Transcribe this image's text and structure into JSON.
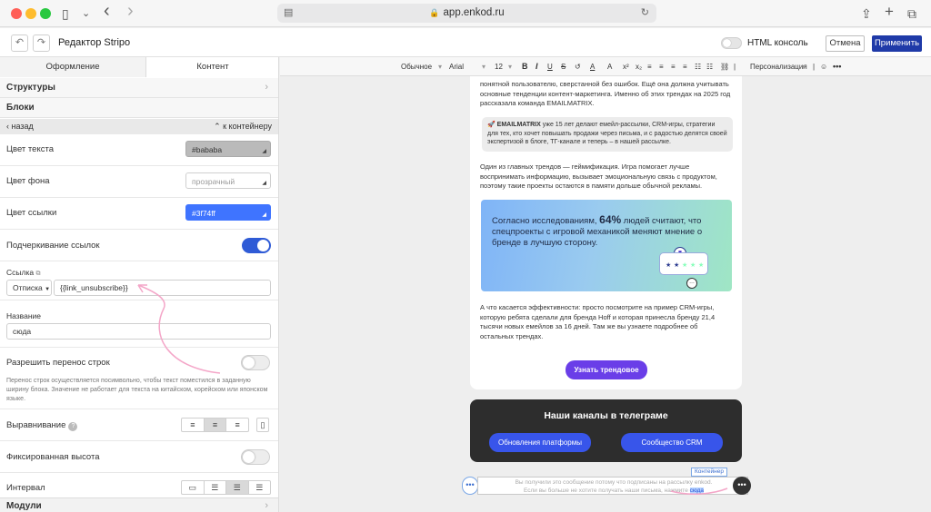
{
  "browser": {
    "url": "app.enkod.ru",
    "sidebar_icon": "▯",
    "chevron": "⌄",
    "back": "‹",
    "forward": "›",
    "share": "⇪",
    "newtab": "+",
    "tabs": "⧉"
  },
  "header": {
    "title": "Редактор Stripo",
    "undo": "↶",
    "redo": "↷",
    "html_console": "HTML консоль",
    "cancel": "Отмена",
    "apply": "Применить"
  },
  "panel": {
    "tabs": [
      "Оформление",
      "Контент"
    ],
    "structures": "Структуры",
    "blocks": "Блоки",
    "back": "назад",
    "to_container": "к контейнеру",
    "text_color_label": "Цвет текста",
    "text_color_value": "#bababa",
    "bg_color_label": "Цвет фона",
    "bg_color_value": "прозрачный",
    "link_color_label": "Цвет ссылки",
    "link_color_value": "#3f74ff",
    "underline_label": "Подчеркивание ссылок",
    "link_label": "Ссылка",
    "link_type": "Отписка",
    "link_value": "{{link_unsubscribe}}",
    "name_label": "Название",
    "name_value": "сюда",
    "wrap_label": "Разрешить перенос строк",
    "wrap_help": "Перенос строк осуществляется посимвольно, чтобы текст поместился в заданную ширину блока. Значение не работает для текста на китайском, корейском или японском языке.",
    "align_label": "Выравнивание",
    "fixed_height_label": "Фиксированная высота",
    "interval_label": "Интервал",
    "modules": "Модули"
  },
  "toolbar": {
    "style": "Обычное",
    "font": "Arial",
    "size": "12",
    "personalization": "Персонализация"
  },
  "email": {
    "para1": "понятной пользователю, сверстанной без ошибок. Ещё она должна учитывать основные тенденции контент-маркетинга. Именно об этих трендах на 2025 год рассказала команда EMAILMATRIX.",
    "quote_brand": "EMAILMATRIX",
    "quote_text": " уже 15 лет делают емейл-рассылки, CRM-игры, стратегии для тех, кто хочет повышать продажи через письма, и с радостью делятся своей экспертизой в блоге, ТГ-канале и теперь – в нашей рассылке.",
    "para2": "Один из главных трендов — геймификация. Игра помогает лучше воспринимать информацию, вызывает эмоциональную связь с продуктом, поэтому такие проекты остаются в памяти дольше обычной рекламы.",
    "banner_pre": "Согласно исследованиям, ",
    "banner_big": "64%",
    "banner_post": " людей считают, что спецпроекты с игровой механикой меняют мнение о бренде в лучшую сторону.",
    "para3": "А что касается эффективности: просто посмотрите на пример CRM-игры, которую ребята сделали для бренда Hoff и которая принесла бренду 21,4 тысячи новых емейлов за 16 дней. Там же вы узнаете подробнее об остальных трендах.",
    "cta": "Узнать трендовое",
    "tg_title": "Наши каналы в телеграме",
    "tg_btn1": "Обновления платформы",
    "tg_btn2": "Сообщество CRM",
    "footer_line1": "Вы получили это сообщение потому что подписаны на рассылку enkod.",
    "footer_line2": "Если вы больше не хотите получать наши письма, нажмите ",
    "footer_link": "сюда",
    "container_label": "Контейнер"
  },
  "colors": {
    "accent": "#2f5bd6",
    "apply": "#1f3aa8",
    "cta": "#6a3ee8",
    "tg_btn": "#3855ea",
    "annotation": "#f4a6c8"
  }
}
